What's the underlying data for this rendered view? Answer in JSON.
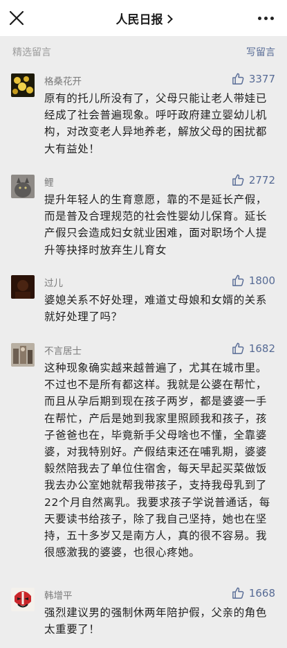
{
  "header": {
    "title": "人民日报",
    "close_icon": "close-icon",
    "more_icon": "more-icon"
  },
  "section": {
    "label": "精选留言",
    "write_label": "写留言"
  },
  "comments": [
    {
      "name": "格桑花开",
      "likes": "3377",
      "text": "原有的托儿所没有了，父母只能让老人带娃已经成了社会普遍现象。呼吁政府建立婴幼儿机构，对改变老人异地养老，解放父母的困扰都大有益处！"
    },
    {
      "name": "鲤",
      "likes": "2772",
      "text": "提升年轻人的生育意愿，靠的不是延长产假，而是普及合理规范的社会性婴幼儿保育。延长产假只会造成妇女就业困难，面对职场个人提升等抉择时放弃生儿育女"
    },
    {
      "name": "过儿",
      "likes": "1800",
      "text": "婆媳关系不好处理，难道丈母娘和女婿的关系就好处理了吗？"
    },
    {
      "name": "不言居士",
      "likes": "1682",
      "text": "这种现象确实越来越普遍了，尤其在城市里。不过也不是所有都这样。我就是公婆在帮忙，而且从孕后期到现在孩子两岁，都是婆婆一手在帮忙，产后是她到我家里照顾我和孩子，孩子爸爸也在，毕竟新手父母啥也不懂，全靠婆婆，对我特别好。产假结束还在哺乳期，婆婆毅然陪我去了单位住宿舍，每天早起买菜做饭我去办公室她就帮我带孩子，支持我母乳到了22个月自然离乳。我要求孩子学说普通话，每天要读书给孩子，除了我自己坚持，她也在坚持，五十多岁又是南方人，真的很不容易。我很感激我的婆婆，也很心疼她。"
    },
    {
      "name": "韩增平",
      "likes": "1668",
      "text": "强烈建议男的强制休两年陪护假，父亲的角色太重要了！"
    }
  ]
}
